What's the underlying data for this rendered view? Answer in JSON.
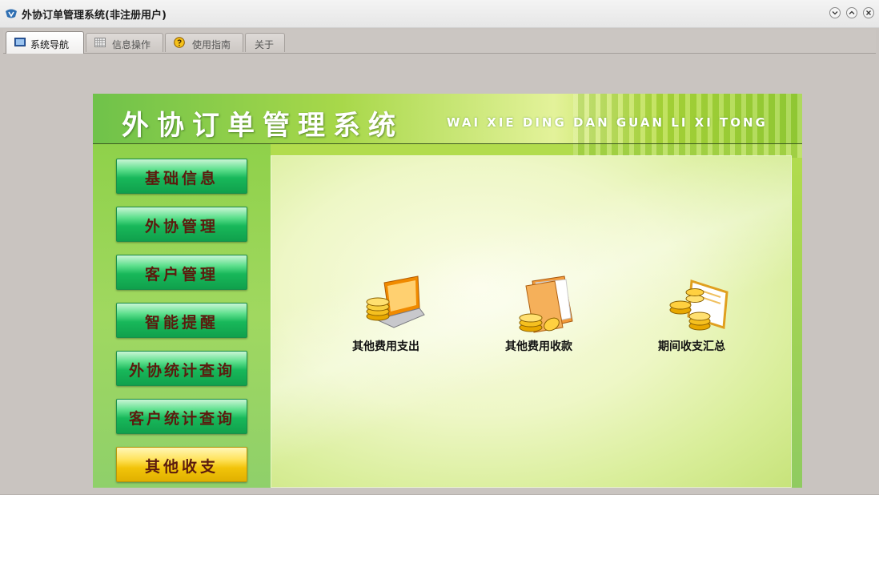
{
  "window": {
    "title": "外协订单管理系统(非注册用户)"
  },
  "tabs": [
    {
      "label": "系统导航",
      "icon": "monitor-icon",
      "active": true
    },
    {
      "label": "信息操作",
      "icon": "grid-icon",
      "active": false
    },
    {
      "label": "使用指南",
      "icon": "help-icon",
      "active": false
    },
    {
      "label": "关于",
      "icon": "",
      "active": false
    }
  ],
  "banner": {
    "title": "外协订单管理系统",
    "pinyin": "WAI XIE DING DAN GUAN LI XI TONG"
  },
  "nav_buttons": [
    {
      "label": "基础信息",
      "style": "green"
    },
    {
      "label": "外协管理",
      "style": "green"
    },
    {
      "label": "客户管理",
      "style": "green"
    },
    {
      "label": "智能提醒",
      "style": "green"
    },
    {
      "label": "外协统计查询",
      "style": "green"
    },
    {
      "label": "客户统计查询",
      "style": "green"
    },
    {
      "label": "其他收支",
      "style": "gold"
    }
  ],
  "functions": [
    {
      "label": "其他费用支出",
      "icon": "laptop-coins-icon"
    },
    {
      "label": "其他费用收款",
      "icon": "folder-coins-icon"
    },
    {
      "label": "期间收支汇总",
      "icon": "coins-document-icon"
    }
  ],
  "colors": {
    "nav_green": "#18b85a",
    "nav_gold": "#f2c40a",
    "nav_text": "#5b1b0e"
  }
}
